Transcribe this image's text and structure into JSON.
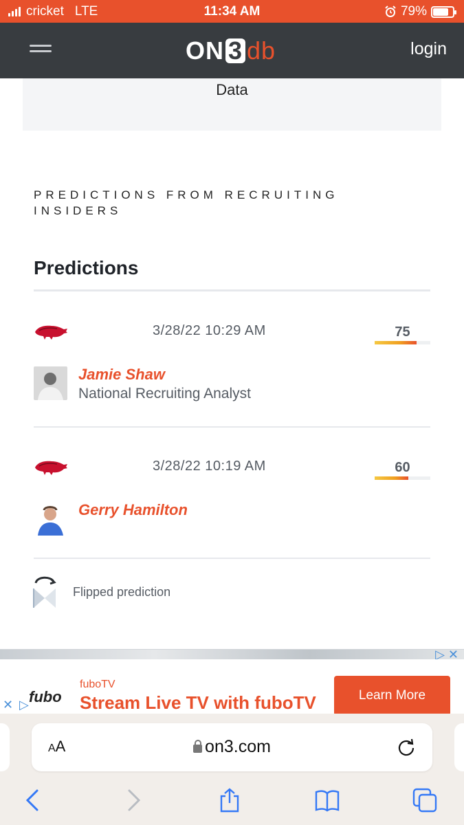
{
  "status_bar": {
    "carrier": "cricket",
    "network": "LTE",
    "time": "11:34 AM",
    "battery": "79%",
    "battery_level": 0.79
  },
  "nav": {
    "logo_on": "ON",
    "logo_three": "3",
    "logo_db": "db",
    "login_label": "login"
  },
  "data_box": {
    "text": "Data"
  },
  "section_label": "PREDICTIONS FROM RECRUITING INSIDERS",
  "predictions_heading": "Predictions",
  "predictions": [
    {
      "date": "3/28/22 10:29 AM",
      "score": "75",
      "score_value": 75,
      "name": "Jamie Shaw",
      "role": "National Recruiting Analyst"
    },
    {
      "date": "3/28/22 10:19 AM",
      "score": "60",
      "score_value": 60,
      "name": "Gerry Hamilton",
      "role": ""
    }
  ],
  "flipped_label": "Flipped prediction",
  "ad": {
    "logo": "fubo",
    "brand": "fuboTV",
    "title": "Stream Live TV with fuboTV",
    "cta": "Learn More"
  },
  "safari": {
    "aa_label_small": "A",
    "aa_label_big": "A",
    "url": "on3.com"
  },
  "colors": {
    "accent": "#e8512c",
    "nav_bg": "#383c40"
  }
}
